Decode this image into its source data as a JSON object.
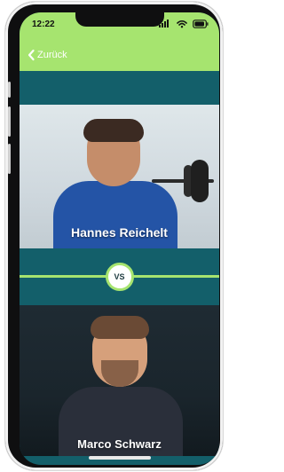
{
  "status_bar": {
    "time": "12:22"
  },
  "nav": {
    "back_label": "Zurück"
  },
  "matchup": {
    "top_name": "Hannes Reichelt",
    "vs_label": "VS",
    "bottom_name": "Marco Schwarz"
  },
  "colors": {
    "accent_green": "#a6e46f",
    "teal": "#135f6a"
  },
  "icons": {
    "back": "chevron-left-icon",
    "signal": "cellular-signal-icon",
    "wifi": "wifi-icon",
    "battery": "battery-icon"
  }
}
